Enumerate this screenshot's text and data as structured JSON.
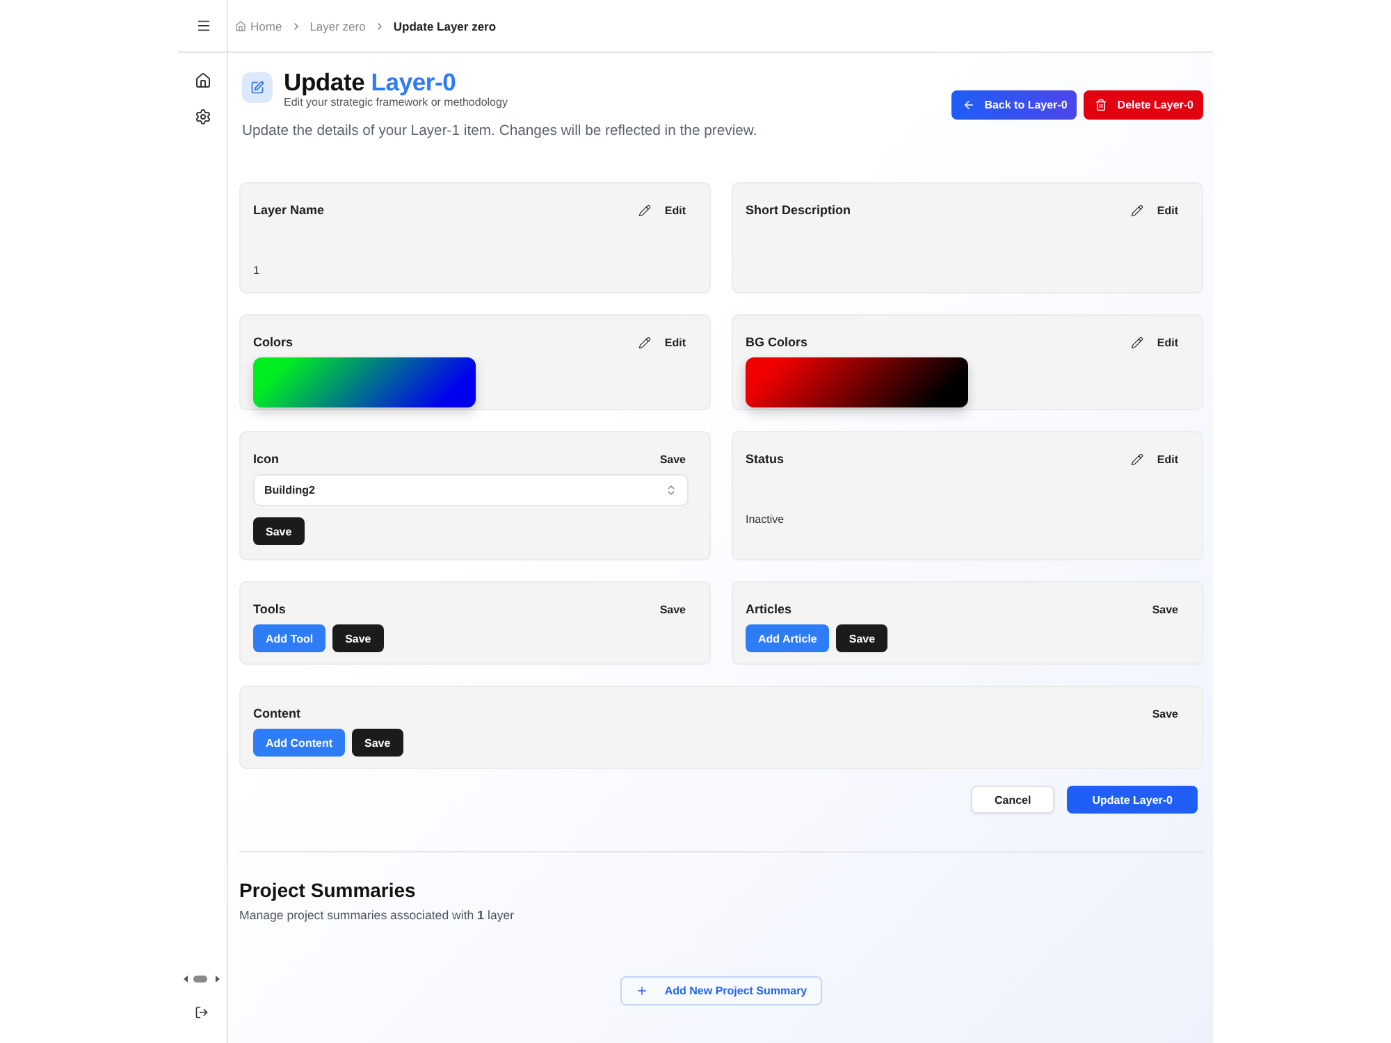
{
  "breadcrumb": [
    {
      "label": "Home",
      "kind": "home"
    },
    {
      "label": "Layer zero",
      "kind": "link"
    },
    {
      "label": "Update Layer zero",
      "kind": "current"
    }
  ],
  "page_header": {
    "title": "Update",
    "title_accent": "Layer-0",
    "subtitle": "Edit your strategic framework or methodology",
    "description": "Update the details of your Layer-1 item. Changes will be reflected in the preview.",
    "actions": [
      {
        "label": "Back to Layer-0",
        "kind": "back"
      },
      {
        "label": "Delete Layer-0",
        "kind": "delete"
      }
    ]
  },
  "cards": [
    {
      "kind": "text",
      "title": "Layer Name",
      "action": {
        "label": "Edit",
        "kind": "edit"
      },
      "value": "1"
    },
    {
      "kind": "text",
      "title": "Short Description",
      "action": {
        "label": "Edit",
        "kind": "edit"
      }
    },
    {
      "kind": "gradient",
      "title": "Colors",
      "action": {
        "label": "Edit",
        "kind": "edit"
      },
      "stops": [
        {
          "color": "#00ee20"
        },
        {
          "color": "#0000f0"
        }
      ]
    },
    {
      "kind": "gradient",
      "title": "BG Colors",
      "action": {
        "label": "Edit",
        "kind": "edit"
      },
      "stops": [
        {
          "color": "#f00000"
        },
        {
          "color": "#000000"
        }
      ]
    },
    {
      "kind": "select",
      "title": "Icon",
      "action": {
        "label": "Save",
        "kind": "save"
      },
      "value": "Building2",
      "button": "Save"
    },
    {
      "kind": "text",
      "title": "Status",
      "action": {
        "label": "Edit",
        "kind": "edit"
      },
      "value": "Inactive"
    },
    {
      "kind": "list",
      "title": "Tools",
      "action": {
        "label": "Save",
        "kind": "save"
      },
      "add_button": "Add Tool",
      "button": "Save"
    },
    {
      "kind": "list",
      "title": "Articles",
      "action": {
        "label": "Save",
        "kind": "save"
      },
      "add_button": "Add Article",
      "button": "Save"
    },
    {
      "kind": "list",
      "title": "Content",
      "action": {
        "label": "Save",
        "kind": "save"
      },
      "add_button": "Add Content",
      "button": "Save"
    }
  ],
  "form_actions": [
    {
      "label": "Cancel",
      "kind": "secondary"
    },
    {
      "label": "Update Layer-0",
      "kind": "primary"
    }
  ],
  "project_summaries": {
    "title": "Project Summaries",
    "subtitle": "Manage project summaries associated with **1** layer",
    "add_button": "Add New Project Summary"
  }
}
